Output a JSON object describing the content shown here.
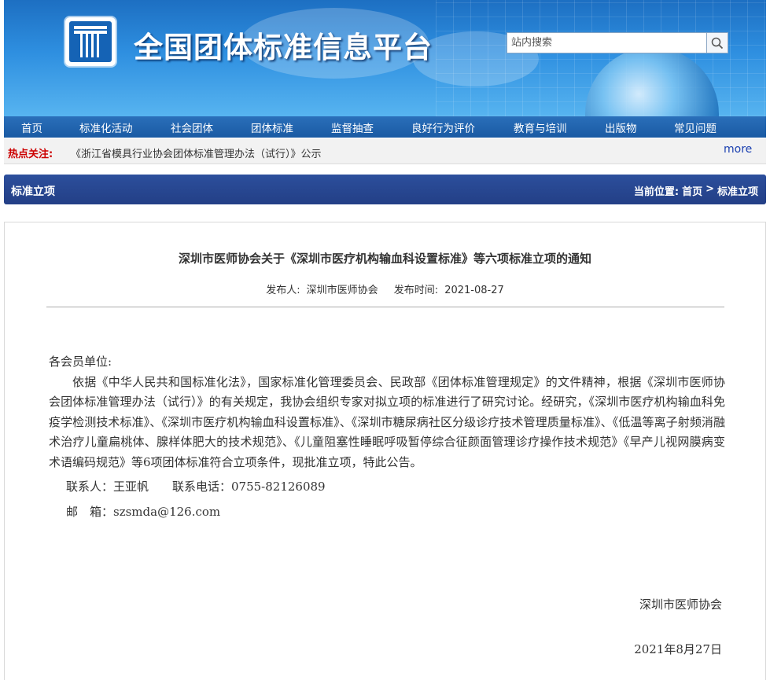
{
  "header": {
    "site_title": "全国团体标准信息平台",
    "search_placeholder": "站内搜索"
  },
  "nav": {
    "items": [
      "首页",
      "标准化活动",
      "社会团体",
      "团体标准",
      "监督抽查",
      "良好行为评价",
      "教育与培训",
      "出版物",
      "常见问题"
    ]
  },
  "hotbar": {
    "label": "热点关注:",
    "link": "《浙江省模具行业协会团体标准管理办法（试行）》公示",
    "more": "more"
  },
  "section": {
    "title": "标准立项",
    "breadcrumb_label": "当前位置:",
    "breadcrumb_home": "首页",
    "breadcrumb_sep": ">",
    "breadcrumb_current": "标准立项"
  },
  "article": {
    "title": "深圳市医师协会关于《深圳市医疗机构输血科设置标准》等六项标准立项的通知",
    "publisher_label": "发布人:",
    "publisher": "深圳市医师协会",
    "date_label": "发布时间:",
    "date": "2021-08-27",
    "salutation": "各会员单位:",
    "body": "依据《中华人民共和国标准化法》，国家标准化管理委员会、民政部《团体标准管理规定》的文件精神，根据《深圳市医师协会团体标准管理办法（试行）》的有关规定，我协会组织专家对拟立项的标准进行了研究讨论。经研究，《深圳市医疗机构输血科免疫学检测技术标准》、《深圳市医疗机构输血科设置标准》、《深圳市糖尿病社区分级诊疗技术管理质量标准》、《低温等离子射频消融术治疗儿童扁桃体、腺样体肥大的技术规范》、《儿童阻塞性睡眠呼吸暂停综合征颜面管理诊疗操作技术规范》《早产儿视网膜病变术语编码规范》等6项团体标准符合立项条件，现批准立项，特此公告。",
    "contact": "联系人：王亚帆　　联系电话：0755-82126089",
    "email": "邮　箱：szsmda@126.com",
    "signature": "深圳市医师协会",
    "sign_date": "2021年8月27日"
  }
}
